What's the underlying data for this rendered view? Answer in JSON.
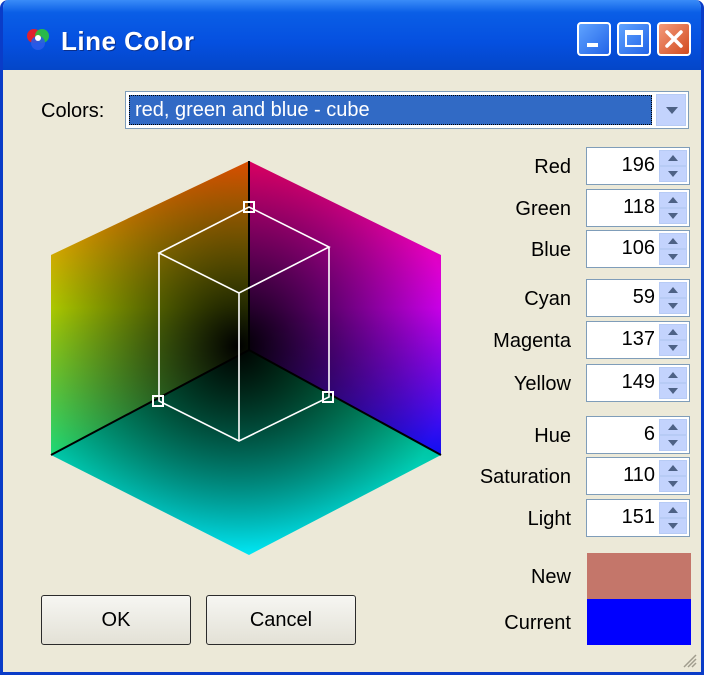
{
  "window": {
    "title": "Line Color"
  },
  "colors_combo": {
    "label": "Colors:",
    "value": "red, green and blue - cube"
  },
  "fields": {
    "red": {
      "label": "Red",
      "value": "196"
    },
    "green": {
      "label": "Green",
      "value": "118"
    },
    "blue": {
      "label": "Blue",
      "value": "106"
    },
    "cyan": {
      "label": "Cyan",
      "value": "59"
    },
    "magenta": {
      "label": "Magenta",
      "value": "137"
    },
    "yellow": {
      "label": "Yellow",
      "value": "149"
    },
    "hue": {
      "label": "Hue",
      "value": "6"
    },
    "saturation": {
      "label": "Saturation",
      "value": "110"
    },
    "light": {
      "label": "Light",
      "value": "151"
    }
  },
  "swatches": {
    "new": {
      "label": "New",
      "color": "#C4766A"
    },
    "current": {
      "label": "Current",
      "color": "#0000FF"
    }
  },
  "buttons": {
    "ok": "OK",
    "cancel": "Cancel"
  },
  "icons": [
    "color-wheel-icon",
    "minimize-icon",
    "maximize-icon",
    "close-icon",
    "dropdown-arrow-icon",
    "spin-up-icon",
    "spin-down-icon",
    "resize-grip-icon"
  ]
}
